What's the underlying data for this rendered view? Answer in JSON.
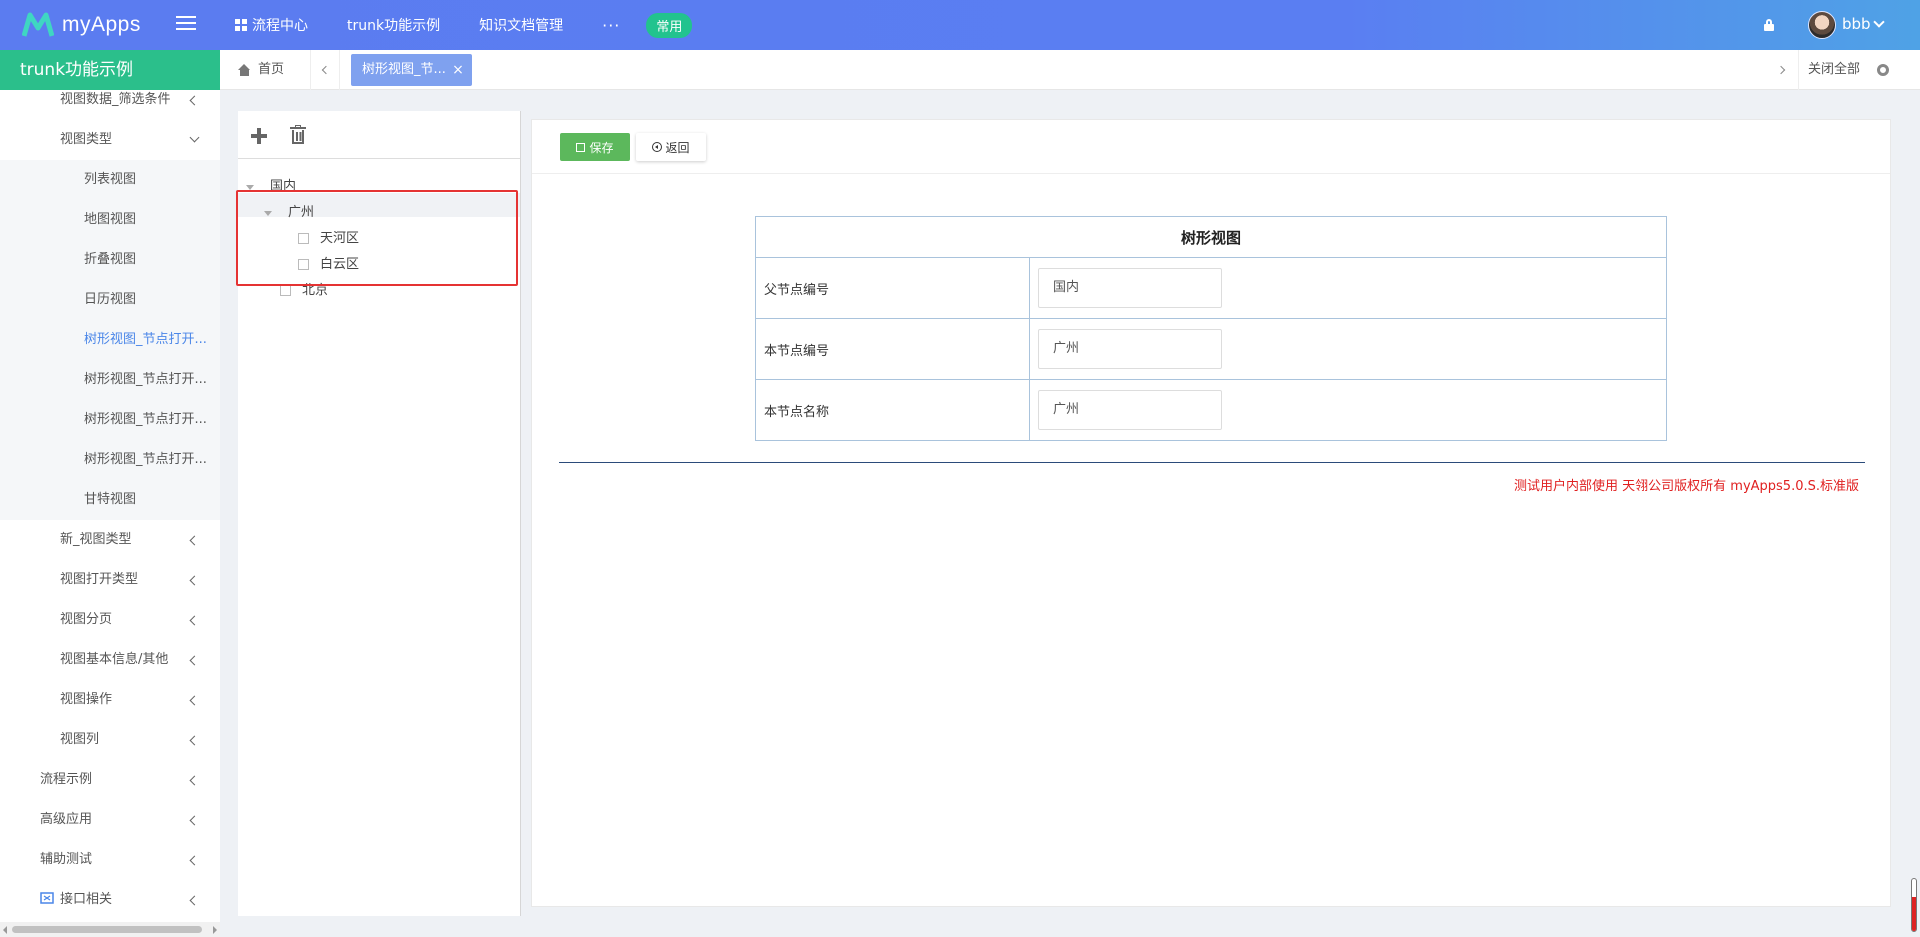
{
  "header": {
    "logo_text": "myApps",
    "nav": [
      {
        "label": "流程中心"
      },
      {
        "label": "trunk功能示例"
      },
      {
        "label": "知识文档管理"
      }
    ],
    "more": "···",
    "common_label": "常用",
    "user_name": "bbb"
  },
  "sidebar": {
    "title": "trunk功能示例",
    "items": [
      {
        "label": "视图数据_筛选条件"
      },
      {
        "label": "视图类型"
      },
      {
        "label": "列表视图"
      },
      {
        "label": "地图视图"
      },
      {
        "label": "折叠视图"
      },
      {
        "label": "日历视图"
      },
      {
        "label": "树形视图_节点打开..."
      },
      {
        "label": "树形视图_节点打开..."
      },
      {
        "label": "树形视图_节点打开..."
      },
      {
        "label": "树形视图_节点打开..."
      },
      {
        "label": "甘特视图"
      },
      {
        "label": "新_视图类型"
      },
      {
        "label": "视图打开类型"
      },
      {
        "label": "视图分页"
      },
      {
        "label": "视图基本信息/其他"
      },
      {
        "label": "视图操作"
      },
      {
        "label": "视图列"
      },
      {
        "label": "流程示例"
      },
      {
        "label": "高级应用"
      },
      {
        "label": "辅助测试"
      },
      {
        "label": "接口相关"
      }
    ]
  },
  "tabs": {
    "home": "首页",
    "active": "树形视图_节...",
    "close_symbol": "×",
    "close_all": "关闭全部"
  },
  "tree": {
    "nodes": [
      {
        "label": "国内"
      },
      {
        "label": "广州"
      },
      {
        "label": "天河区"
      },
      {
        "label": "白云区"
      },
      {
        "label": "北京"
      }
    ]
  },
  "form": {
    "save_label": "保存",
    "back_label": "返回",
    "title": "树形视图",
    "rows": [
      {
        "label": "父节点编号",
        "value": "国内"
      },
      {
        "label": "本节点编号",
        "value": "广州"
      },
      {
        "label": "本节点名称",
        "value": "广州"
      }
    ],
    "footer": "测试用户内部使用 天翎公司版权所有 myApps5.0.S.标准版"
  },
  "colors": {
    "topbar": "#5b7cf0",
    "sidebar_title": "#2bbf8b",
    "active_tab": "#7fa1ef",
    "save_button": "#5cb85c",
    "highlight_box": "#e53333",
    "footer_text": "#e02020"
  }
}
